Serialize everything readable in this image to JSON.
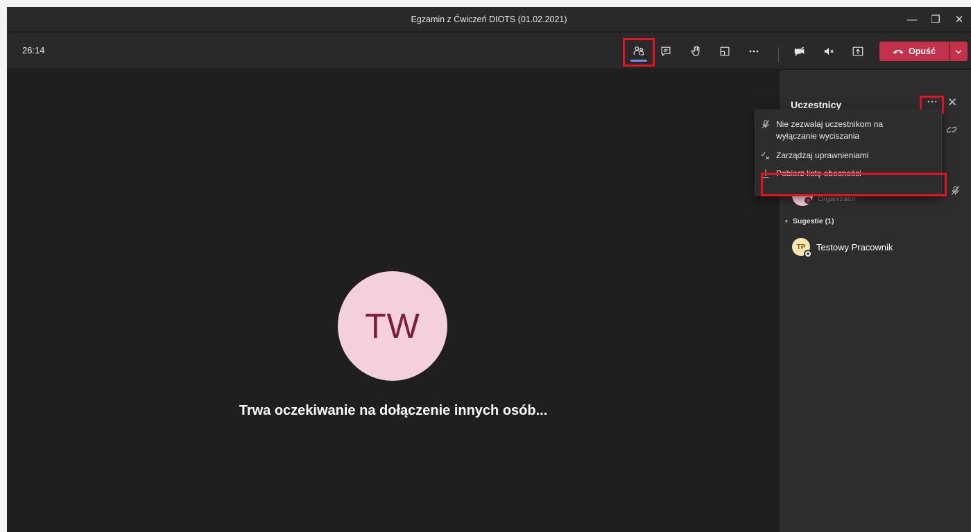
{
  "window": {
    "title": "Egzamin z Ćwiczeń DIOTS (01.02.2021)",
    "controls": {
      "minimize": "—",
      "restore": "❐",
      "close": "✕"
    }
  },
  "toolbar": {
    "timer": "26:14",
    "icons": [
      "people-icon",
      "chat-icon",
      "raise-hand-icon",
      "rooms-icon",
      "more-actions-icon",
      "camera-off-icon",
      "mic-muted-icon",
      "share-screen-icon"
    ],
    "leave_label": "Opuść"
  },
  "stage": {
    "avatar_initials": "TW",
    "waiting_message": "Trwa oczekiwanie na dołączenie innych osób..."
  },
  "participants_panel": {
    "title": "Uczestnicy",
    "more_glyph": "···",
    "close_glyph": "✕",
    "organizer_role": "Organizator",
    "suggestions_header": "Sugestie (1)",
    "suggestions": [
      {
        "initials": "TP",
        "name": "Testowy Pracownik"
      }
    ]
  },
  "context_menu": {
    "items": [
      {
        "label": "Nie zezwalaj uczestnikom na wyłączanie wyciszania",
        "icon": "mic-off-icon"
      },
      {
        "label": "Zarządzaj uprawnieniami",
        "icon": "permissions-icon"
      },
      {
        "label": "Pobierz listę obecności",
        "icon": "download-icon"
      }
    ]
  },
  "colors": {
    "accent": "#7f85f5",
    "leave": "#c4314b",
    "highlight": "#e81123",
    "avatar_bg": "#f4d0dd",
    "avatar_text": "#7a1e3e"
  }
}
